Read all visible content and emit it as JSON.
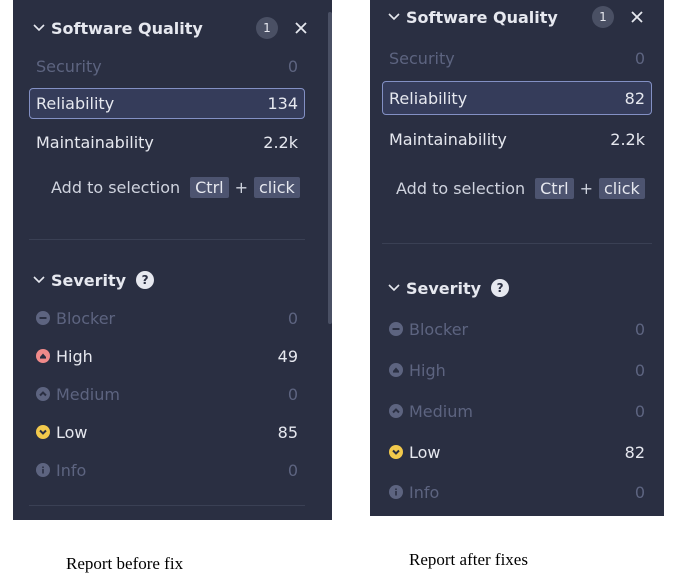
{
  "captions": {
    "before": "Report before fix",
    "after": "Report after fixes"
  },
  "before": {
    "software_quality": {
      "title": "Software Quality",
      "badge": "1",
      "items": [
        {
          "label": "Security",
          "count": "0"
        },
        {
          "label": "Reliability",
          "count": "134"
        },
        {
          "label": "Maintainability",
          "count": "2.2k"
        }
      ]
    },
    "hint": {
      "text": "Add to selection",
      "key1": "Ctrl",
      "plus": "+",
      "key2": "click"
    },
    "severity": {
      "title": "Severity",
      "help": "?",
      "items": [
        {
          "label": "Blocker",
          "count": "0"
        },
        {
          "label": "High",
          "count": "49"
        },
        {
          "label": "Medium",
          "count": "0"
        },
        {
          "label": "Low",
          "count": "85"
        },
        {
          "label": "Info",
          "count": "0"
        }
      ]
    }
  },
  "after": {
    "software_quality": {
      "title": "Software Quality",
      "badge": "1",
      "items": [
        {
          "label": "Security",
          "count": "0"
        },
        {
          "label": "Reliability",
          "count": "82"
        },
        {
          "label": "Maintainability",
          "count": "2.2k"
        }
      ]
    },
    "hint": {
      "text": "Add to selection",
      "key1": "Ctrl",
      "plus": "+",
      "key2": "click"
    },
    "severity": {
      "title": "Severity",
      "help": "?",
      "items": [
        {
          "label": "Blocker",
          "count": "0"
        },
        {
          "label": "High",
          "count": "0"
        },
        {
          "label": "Medium",
          "count": "0"
        },
        {
          "label": "Low",
          "count": "82"
        },
        {
          "label": "Info",
          "count": "0"
        }
      ]
    }
  },
  "colors": {
    "panel_bg": "#2a2f42",
    "selected_border": "#8390c4",
    "disabled_text": "#5d6480",
    "high_icon": "#f08a8a",
    "low_icon": "#f2c94c"
  },
  "icons": {
    "blocker": "minus-circle-icon",
    "high": "arrow-up-circle-icon",
    "medium": "chevron-up-circle-icon",
    "low": "chevron-down-circle-icon",
    "info": "info-circle-icon"
  }
}
